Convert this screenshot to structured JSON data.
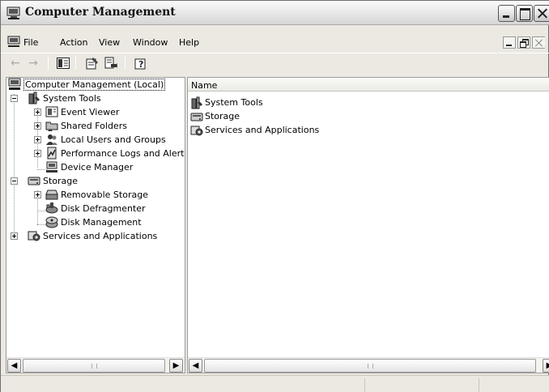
{
  "window": {
    "title": "Computer Management",
    "title_icon": "computer-management-icon"
  },
  "menubar": {
    "items": [
      "File",
      "Action",
      "View",
      "Window",
      "Help"
    ]
  },
  "toolbar": {
    "buttons": [
      "back-arrow-icon",
      "forward-arrow-icon",
      "show-hide-tree-icon",
      "properties-icon",
      "export-list-icon",
      "help-icon"
    ]
  },
  "tree": {
    "root": "Computer Management (Local)",
    "system_tools": "System Tools",
    "event_viewer": "Event Viewer",
    "shared_folders": "Shared Folders",
    "local_users": "Local Users and Groups",
    "perf_logs": "Performance Logs and Alerts",
    "device_manager": "Device Manager",
    "storage": "Storage",
    "removable_storage": "Removable Storage",
    "disk_defrag": "Disk Defragmenter",
    "disk_mgmt": "Disk Management",
    "services_apps": "Services and Applications"
  },
  "list": {
    "column_name": "Name",
    "rows": [
      "System Tools",
      "Storage",
      "Services and Applications"
    ]
  },
  "scrollbar": {
    "grip": "III"
  },
  "colors": {
    "chrome": "#ebe9e1",
    "titlebar": "#d6d6d6",
    "pane_border": "#9c9c9c"
  }
}
